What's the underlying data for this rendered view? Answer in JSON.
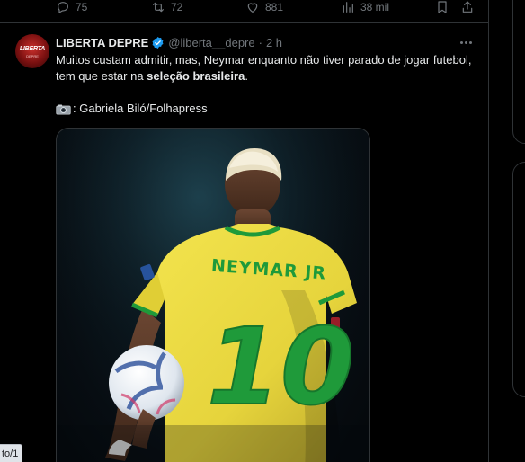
{
  "prev_tweet_actions": {
    "replies": "75",
    "retweets": "72",
    "likes": "881",
    "views": "38 mil"
  },
  "tweet": {
    "display_name": "LIBERTA DEPRE",
    "handle": "@liberta__depre",
    "separator": "·",
    "time": "2 h",
    "text_plain": "Muitos custam admitir, mas, Neymar enquanto não tiver parado de jogar futebol, tem que estar na ",
    "text_bold": "seleção brasileira",
    "text_end": ".",
    "credit": ": Gabriela Biló/Folhapress",
    "avatar_text": "LIBERTA",
    "avatar_subtext": "DEPRE",
    "media": {
      "jersey_name": "NEYMAR JR",
      "jersey_number": "10"
    }
  },
  "status_tip": "to/1",
  "colors": {
    "background": "#000000",
    "text": "#e7e9ea",
    "muted": "#71767b",
    "border": "#2f3336",
    "verified": "#1d9bf0",
    "jersey_yellow": "#f2e24a",
    "jersey_green": "#1f9a3a"
  },
  "icons": {
    "reply": "reply-icon",
    "retweet": "retweet-icon",
    "like": "heart-icon",
    "views": "views-icon",
    "bookmark": "bookmark-icon",
    "share": "share-icon",
    "verified": "verified-badge-icon",
    "more": "more-icon",
    "camera": "camera-icon"
  }
}
